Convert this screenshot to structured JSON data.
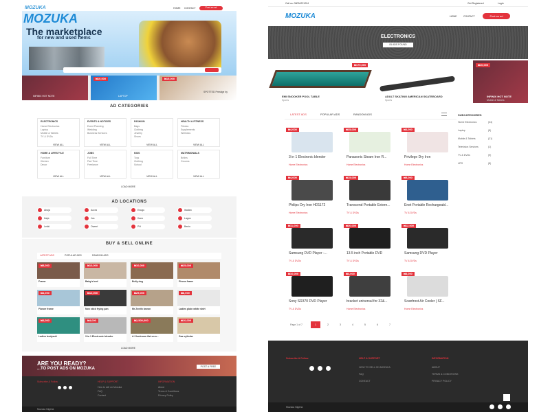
{
  "left": {
    "header": {
      "logo": "MOZUKA",
      "nav": [
        "HOME",
        "CONTACT"
      ],
      "post_btn": "Post an ad"
    },
    "hero": {
      "logo": "MOZUKA",
      "title": "The marketplace",
      "subtitle": "for new and used items"
    },
    "featured": [
      {
        "price": "",
        "label": "INFINIX HOT NOTE"
      },
      {
        "price": "₦10,000",
        "label": "LAPTOP"
      },
      {
        "price": "₦15,000",
        "label": "SPOTTED Prestige by"
      }
    ],
    "categories": {
      "title": "AD CATEGORIES",
      "groups": [
        {
          "name": "ELECTRONICS",
          "items": [
            "Home Electronics",
            "Laptop",
            "Mobile & Tablets",
            "TV & DVDs"
          ],
          "viewall": "VIEW ALL"
        },
        {
          "name": "EVENTS & NOTICES",
          "items": [
            "Event Planning",
            "Wedding",
            "Business Services"
          ],
          "viewall": "VIEW ALL"
        },
        {
          "name": "FASHION",
          "items": [
            "Bags",
            "Clothing",
            "Jewelry",
            "Shoes"
          ],
          "viewall": "VIEW ALL"
        },
        {
          "name": "HEALTH & FITNESS",
          "items": [
            "Fitness",
            "Supplements",
            "Wellness"
          ],
          "viewall": "VIEW ALL"
        },
        {
          "name": "HOME & LIFESTYLE",
          "items": [
            "Furniture",
            "Kitchen",
            "Decor"
          ],
          "viewall": "VIEW ALL"
        },
        {
          "name": "JOBS",
          "items": [
            "Full Time",
            "Part Time",
            "Freelance"
          ],
          "viewall": "VIEW ALL"
        },
        {
          "name": "KIDS",
          "items": [
            "Toys",
            "Clothing",
            "School"
          ],
          "viewall": "VIEW ALL"
        },
        {
          "name": "MATRIMONIALS",
          "items": [
            "Brides",
            "Grooms"
          ],
          "viewall": "VIEW ALL"
        }
      ],
      "loadmore": "LOAD MORE"
    },
    "locations": {
      "title": "AD LOCATIONS",
      "items": [
        "Abuja",
        "Accra",
        "Enugu",
        "Ibadan",
        "Ikeja",
        "Jos",
        "Kano",
        "Lagos",
        "Lekki",
        "Owerri",
        "PH",
        "Benin"
      ]
    },
    "buysell": {
      "title": "BUY & SELL ONLINE",
      "tabs": [
        "LATEST ADS",
        "POPULAR ADS",
        "RANDOM ADS"
      ],
      "items": [
        {
          "price": "₦5,000",
          "title": "Frame"
        },
        {
          "price": "₦10,000",
          "title": "Baby's bed"
        },
        {
          "price": "₦10,000",
          "title": "Bully dog"
        },
        {
          "price": "₦25,000",
          "title": "Phone frame"
        },
        {
          "price": "₦4,000",
          "title": "Flower frame"
        },
        {
          "price": "₦12,000",
          "title": "Non stick frying pan"
        },
        {
          "price": "₦25,000",
          "title": "Mr Zenith brown"
        },
        {
          "price": "₦8,000",
          "title": "Ladies plain white shirt"
        },
        {
          "price": "₦3,000",
          "title": "Ladies bodysuit"
        },
        {
          "price": "₦4,000",
          "title": "3 in 1 Electronic blender"
        },
        {
          "price": "₦2,500,000",
          "title": "A 3 bedroom flat on a..."
        },
        {
          "price": "₦10,000",
          "title": "Gas cylinder"
        }
      ],
      "loadmore": "LOAD MORE"
    },
    "banner": {
      "line1": "ARE YOU READY?",
      "line2": "...TO POST ADS ON MOZUKA",
      "btn": "POST A FREE"
    },
    "footer": {
      "cols": [
        "Subscribe & Follow",
        "HELP & SUPPORT",
        "INFORMATION"
      ],
      "help": [
        "How to sell on Mozuka",
        "FAQ",
        "Contact"
      ],
      "info": [
        "About",
        "Terms & Conditions",
        "Privacy Policy"
      ],
      "copyright": "Mozuka Nigeria"
    }
  },
  "right": {
    "header": {
      "call": "Call us: 08034221204",
      "register": "Get Registered",
      "login": "Login",
      "logo": "MOZUKA",
      "nav": [
        "HOME",
        "CONTACT"
      ],
      "post_btn": "Post an ad"
    },
    "banner": {
      "title": "ELECTRONICS",
      "count": "81 ADS FOUND"
    },
    "slider": [
      {
        "price": "₦170,000",
        "title": "EMI SNOOKER POOL TABLE",
        "sub": "Sports"
      },
      {
        "price": "",
        "title": "ADULT SKATING AMERICAN SKATEBOARD",
        "sub": "Sports"
      },
      {
        "price": "₦10,000",
        "title": "INFINIX HOT NOTE",
        "sub": "Mobile & Tablets"
      }
    ],
    "tabs": [
      "LATEST ADS",
      "POPULAR ADS",
      "RANDOM ADS"
    ],
    "products": [
      {
        "price": "₦4,000",
        "title": "3 in 1 Electronic blender",
        "cat": "Home Electronics"
      },
      {
        "price": "₦35,000",
        "title": "Panasonic Steam Iron R...",
        "cat": "Home Electronics"
      },
      {
        "price": "₦3,000",
        "title": "Privilege Dry Iron",
        "cat": "Home Electronics"
      },
      {
        "price": "₦4,000",
        "title": "Philips Dry Iron HD1172",
        "cat": "Home Electronics"
      },
      {
        "price": "₦15,000",
        "title": "Transcend Portable Extern...",
        "cat": "TV & DVDs"
      },
      {
        "price": "₦5,000",
        "title": "Enet Portable Rechargeabl...",
        "cat": "TV & DVDs"
      },
      {
        "price": "₦11,000",
        "title": "Samsung DVD Player -...",
        "cat": "TV & DVDs"
      },
      {
        "price": "₦20,000",
        "title": "13.5 inch Portable DVD",
        "cat": "TV & DVDs"
      },
      {
        "price": "₦12,000",
        "title": "Samsung DVD Player",
        "cat": "TV & DVDs"
      },
      {
        "price": "₦10,000",
        "title": "Sony SR370 DVD Player",
        "cat": "TV & DVDs"
      },
      {
        "price": "₦4,000",
        "title": "bracket universal for 32&...",
        "cat": "Home Electronics"
      },
      {
        "price": "₦8,000",
        "title": "Scanfrost Air Cooler | SF...",
        "cat": "Home Electronics"
      }
    ],
    "pagination": {
      "label": "Page 1 of 7",
      "pages": [
        "1",
        "2",
        "3",
        "4",
        "5",
        "6",
        "7"
      ]
    },
    "subcategories": {
      "title": "SUBCATEGORIES",
      "items": [
        {
          "name": "Home Electronics",
          "count": "(34)"
        },
        {
          "name": "Laptop",
          "count": "(8)"
        },
        {
          "name": "Mobile & Tablets",
          "count": "(21)"
        },
        {
          "name": "Television Services",
          "count": "(1)"
        },
        {
          "name": "TV & DVDs",
          "count": "(9)"
        },
        {
          "name": "UPS",
          "count": "(8)"
        }
      ]
    },
    "footer": {
      "cols": [
        "Subscribe & Follow",
        "HELP & SUPPORT",
        "INFORMATION"
      ],
      "help": [
        "HOW TO SELL ON MOZUKA",
        "FAQ",
        "CONTACT"
      ],
      "info": [
        "ABOUT",
        "TERMS & CONDITIONS",
        "PRIVACY POLICY"
      ],
      "copyright": "Mozuka Nigeria"
    }
  },
  "colors": {
    "accent": "#e3333c",
    "dark": "#2b2b2b",
    "maroon": "#5a2a32"
  }
}
